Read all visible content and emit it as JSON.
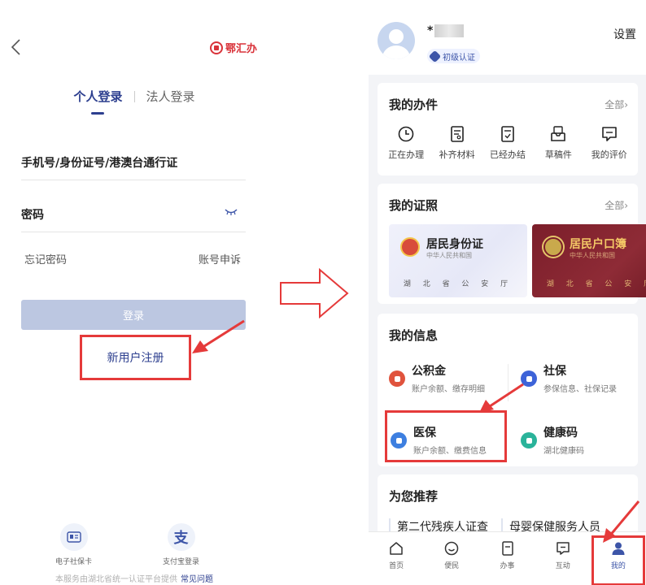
{
  "login": {
    "brand": "鄂汇办",
    "tabs": {
      "personal": "个人登录",
      "legal": "法人登录"
    },
    "id_field_label": "手机号/身份证号/港澳台通行证",
    "password_label": "密码",
    "forgot_password": "忘记密码",
    "appeal": "账号申诉",
    "login_button": "登录",
    "register_link": "新用户注册",
    "alt_logins": [
      {
        "label": "电子社保卡",
        "icon": "social-security-card-icon"
      },
      {
        "label": "支付宝登录",
        "icon": "alipay-icon"
      }
    ],
    "footer": {
      "text": "本服务由湖北省统一认证平台提供",
      "link": "常见问题"
    }
  },
  "profile": {
    "username_masked": "*",
    "verification_badge": "初级认证",
    "settings": "设置",
    "my_tasks": {
      "title": "我的办件",
      "more": "全部›",
      "items": [
        {
          "label": "正在办理",
          "icon": "clock-icon"
        },
        {
          "label": "补齐材料",
          "icon": "document-supplement-icon"
        },
        {
          "label": "已经办结",
          "icon": "document-check-icon"
        },
        {
          "label": "草稿件",
          "icon": "draft-inbox-icon"
        },
        {
          "label": "我的评价",
          "icon": "comment-icon"
        }
      ]
    },
    "my_licenses": {
      "title": "我的证照",
      "more": "全部›",
      "items": [
        {
          "name": "居民身份证",
          "sub": "中华人民共和国",
          "dept": "湖 北 省 公 安 厅"
        },
        {
          "name": "居民户口簿",
          "sub": "中华人民共和国",
          "dept": "湖 北 省 公 安 厅"
        }
      ]
    },
    "my_info": {
      "title": "我的信息",
      "items": [
        {
          "name": "公积金",
          "desc": "账户余额、缴存明细",
          "color": "#e0533d"
        },
        {
          "name": "社保",
          "desc": "参保信息、社保记录",
          "color": "#3d63d8"
        },
        {
          "name": "医保",
          "desc": "账户余额、缴费信息",
          "color": "#3d7fe0"
        },
        {
          "name": "健康码",
          "desc": "湖北健康码",
          "color": "#2ab39a"
        }
      ]
    },
    "recommend": {
      "title": "为您推荐",
      "items": [
        "第二代残疾人证查",
        "母婴保健服务人员"
      ]
    },
    "tabbar": [
      {
        "label": "首页",
        "icon": "home-icon"
      },
      {
        "label": "便民",
        "icon": "convenience-icon"
      },
      {
        "label": "办事",
        "icon": "affairs-icon"
      },
      {
        "label": "互动",
        "icon": "interaction-icon"
      },
      {
        "label": "我的",
        "icon": "person-icon",
        "active": true
      }
    ]
  },
  "colors": {
    "accent_blue": "#2d3f8f",
    "highlight_red": "#e53a3a",
    "login_disabled": "#bcc7e1"
  }
}
